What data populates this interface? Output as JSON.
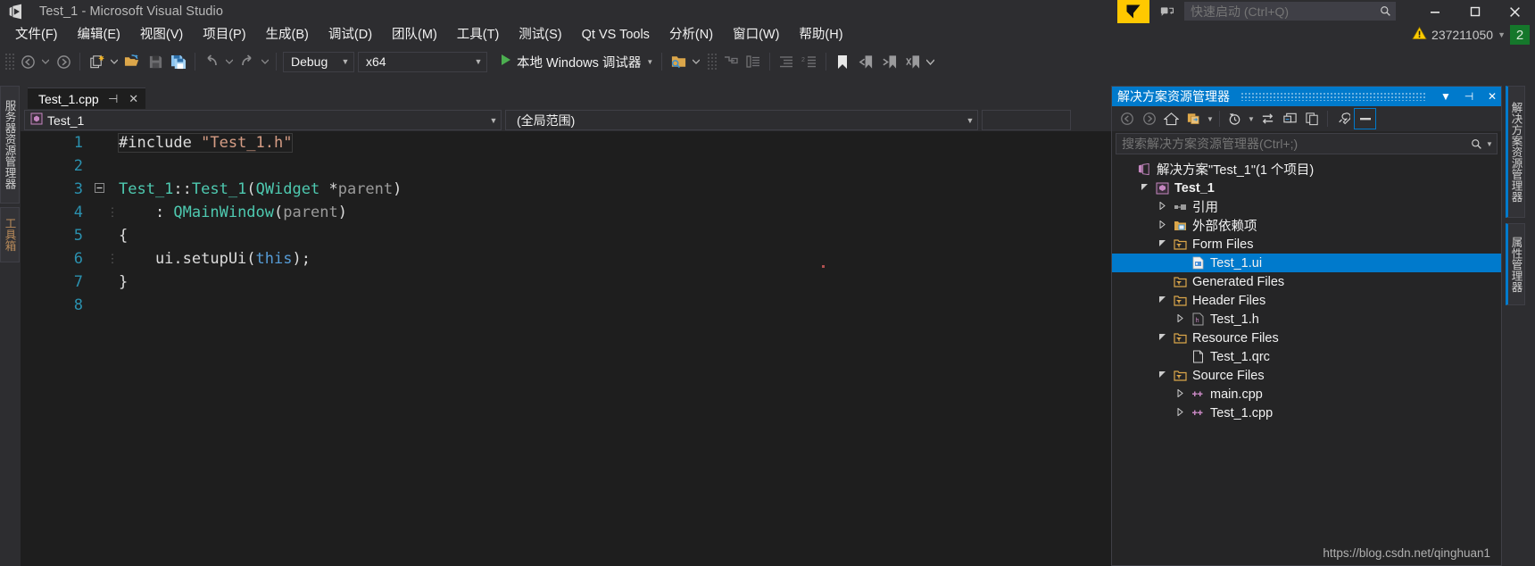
{
  "window": {
    "title": "Test_1 - Microsoft Visual Studio",
    "logo_icon": "visual-studio-logo",
    "minimize_icon": "minimize-icon",
    "maximize_icon": "maximize-icon",
    "close_icon": "close-icon"
  },
  "quick_launch": {
    "placeholder": "快速启动 (Ctrl+Q)",
    "value": "",
    "search_icon": "search-icon",
    "feedback_icon": "feedback-icon",
    "qt_logo": "qt-logo"
  },
  "menubar": {
    "items": [
      {
        "label": "文件(F)"
      },
      {
        "label": "编辑(E)"
      },
      {
        "label": "视图(V)"
      },
      {
        "label": "项目(P)"
      },
      {
        "label": "生成(B)"
      },
      {
        "label": "调试(D)"
      },
      {
        "label": "团队(M)"
      },
      {
        "label": "工具(T)"
      },
      {
        "label": "测试(S)"
      },
      {
        "label": "Qt VS Tools"
      },
      {
        "label": "分析(N)"
      },
      {
        "label": "窗口(W)"
      },
      {
        "label": "帮助(H)"
      }
    ]
  },
  "notification": {
    "warning_icon": "warning-icon",
    "count_text": "237211050",
    "caret_icon": "chevron-down-icon",
    "badge_text": "2",
    "badge_color": "#15772b"
  },
  "toolbar": {
    "navigate_back_icon": "navigate-back-icon",
    "navigate_forward_icon": "navigate-forward-icon",
    "new_project_icon": "new-project-icon",
    "open_file_icon": "open-file-icon",
    "save_icon": "save-icon",
    "save_all_icon": "save-all-icon",
    "undo_icon": "undo-icon",
    "redo_icon": "redo-icon",
    "configuration": {
      "value": "Debug",
      "caret_icon": "chevron-down-icon"
    },
    "platform": {
      "value": "x64",
      "caret_icon": "chevron-down-icon"
    },
    "start_debug": {
      "label": "本地 Windows 调试器",
      "play_icon": "play-icon",
      "caret_icon": "chevron-down-icon"
    },
    "find_in_files_icon": "find-in-files-icon",
    "step_icons": [
      "step-into-icon",
      "step-over-icon"
    ],
    "indent_icons": [
      "indent-icon",
      "outdent-icon"
    ],
    "bookmark_icons": [
      "bookmark-icon",
      "previous-bookmark-icon",
      "next-bookmark-icon",
      "clear-bookmarks-icon"
    ]
  },
  "left_tabs": [
    {
      "label": "服务器资源管理器"
    },
    {
      "label": "工具箱"
    }
  ],
  "right_tabs": [
    {
      "label": "解决方案资源管理器"
    },
    {
      "label": "属性管理器"
    }
  ],
  "editor": {
    "tab": {
      "name": "Test_1.cpp",
      "pin_icon": "pin-icon",
      "close_icon": "close-icon"
    },
    "nav_left": {
      "value": "Test_1",
      "icon": "class-icon",
      "caret_icon": "chevron-down-icon"
    },
    "nav_right": {
      "value": "(全局范围)",
      "caret_icon": "chevron-down-icon"
    },
    "lines": [
      {
        "num": "1",
        "fold": "",
        "tokens": [
          {
            "t": "#include ",
            "c": "c-pp"
          },
          {
            "t": "\"Test_1.h\"",
            "c": "c-str"
          }
        ]
      },
      {
        "num": "2",
        "fold": "",
        "tokens": []
      },
      {
        "num": "3",
        "fold": "minus",
        "tokens": [
          {
            "t": "Test_1",
            "c": "c-type"
          },
          {
            "t": "::",
            "c": "c-punct"
          },
          {
            "t": "Test_1",
            "c": "c-type"
          },
          {
            "t": "(",
            "c": "c-punct"
          },
          {
            "t": "QWidget",
            "c": "c-type"
          },
          {
            "t": " *",
            "c": "c-punct"
          },
          {
            "t": "parent",
            "c": "c-param"
          },
          {
            "t": ")",
            "c": "c-punct"
          }
        ]
      },
      {
        "num": "4",
        "fold": "",
        "tokens": [
          {
            "t": "    : ",
            "c": "c-punct"
          },
          {
            "t": "QMainWindow",
            "c": "c-type"
          },
          {
            "t": "(",
            "c": "c-punct"
          },
          {
            "t": "parent",
            "c": "c-param"
          },
          {
            "t": ")",
            "c": "c-punct"
          }
        ]
      },
      {
        "num": "5",
        "fold": "",
        "tokens": [
          {
            "t": "{",
            "c": "c-punct"
          }
        ]
      },
      {
        "num": "6",
        "fold": "",
        "tokens": [
          {
            "t": "    ui.setupUi",
            "c": "c-plain"
          },
          {
            "t": "(",
            "c": "c-punct"
          },
          {
            "t": "this",
            "c": "c-kw"
          },
          {
            "t": ");",
            "c": "c-punct"
          }
        ]
      },
      {
        "num": "7",
        "fold": "",
        "tokens": [
          {
            "t": "}",
            "c": "c-punct"
          }
        ]
      },
      {
        "num": "8",
        "fold": "",
        "tokens": []
      }
    ]
  },
  "solution_explorer": {
    "title": "解决方案资源管理器",
    "title_color": "#007acc",
    "header_icons": {
      "dropdown_icon": "chevron-down-icon",
      "pin_icon": "pin-icon",
      "close_icon": "close-icon"
    },
    "toolbar_icons": [
      "back-icon",
      "forward-icon",
      "home-icon",
      "sync-with-active-document-icon",
      "pending-changes-filter-icon",
      "refresh-icon",
      "collapse-all-icon",
      "show-all-files-icon",
      "properties-icon",
      "preview-selected-items-icon"
    ],
    "search": {
      "placeholder": "搜索解决方案资源管理器(Ctrl+;)",
      "value": "",
      "search_icon": "search-icon",
      "caret_icon": "chevron-down-icon"
    },
    "tree": [
      {
        "indent": 0,
        "twisty": "",
        "icon": "solution-icon",
        "label": "解决方案\"Test_1\"(1 个项目)",
        "bold": false,
        "selected": false
      },
      {
        "indent": 1,
        "twisty": "open",
        "icon": "project-icon",
        "label": "Test_1",
        "bold": true,
        "selected": false
      },
      {
        "indent": 2,
        "twisty": "closed",
        "icon": "references-icon",
        "label": "引用",
        "bold": false,
        "selected": false
      },
      {
        "indent": 2,
        "twisty": "closed",
        "icon": "folder-ext-icon",
        "label": "外部依赖项",
        "bold": false,
        "selected": false
      },
      {
        "indent": 2,
        "twisty": "open",
        "icon": "filter-folder-icon",
        "label": "Form Files",
        "bold": false,
        "selected": false
      },
      {
        "indent": 3,
        "twisty": "",
        "icon": "ui-file-icon",
        "label": "Test_1.ui",
        "bold": false,
        "selected": true
      },
      {
        "indent": 2,
        "twisty": "",
        "icon": "filter-folder-icon",
        "label": "Generated Files",
        "bold": false,
        "selected": false
      },
      {
        "indent": 2,
        "twisty": "open",
        "icon": "filter-folder-icon",
        "label": "Header Files",
        "bold": false,
        "selected": false
      },
      {
        "indent": 3,
        "twisty": "closed",
        "icon": "h-file-icon",
        "label": "Test_1.h",
        "bold": false,
        "selected": false
      },
      {
        "indent": 2,
        "twisty": "open",
        "icon": "filter-folder-icon",
        "label": "Resource Files",
        "bold": false,
        "selected": false
      },
      {
        "indent": 3,
        "twisty": "",
        "icon": "generic-file-icon",
        "label": "Test_1.qrc",
        "bold": false,
        "selected": false
      },
      {
        "indent": 2,
        "twisty": "open",
        "icon": "filter-folder-icon",
        "label": "Source Files",
        "bold": false,
        "selected": false
      },
      {
        "indent": 3,
        "twisty": "closed",
        "icon": "cpp-file-icon",
        "label": "main.cpp",
        "bold": false,
        "selected": false
      },
      {
        "indent": 3,
        "twisty": "closed",
        "icon": "cpp-file-icon",
        "label": "Test_1.cpp",
        "bold": false,
        "selected": false
      }
    ]
  },
  "watermark": {
    "text": "https://blog.csdn.net/qinghuan1"
  }
}
